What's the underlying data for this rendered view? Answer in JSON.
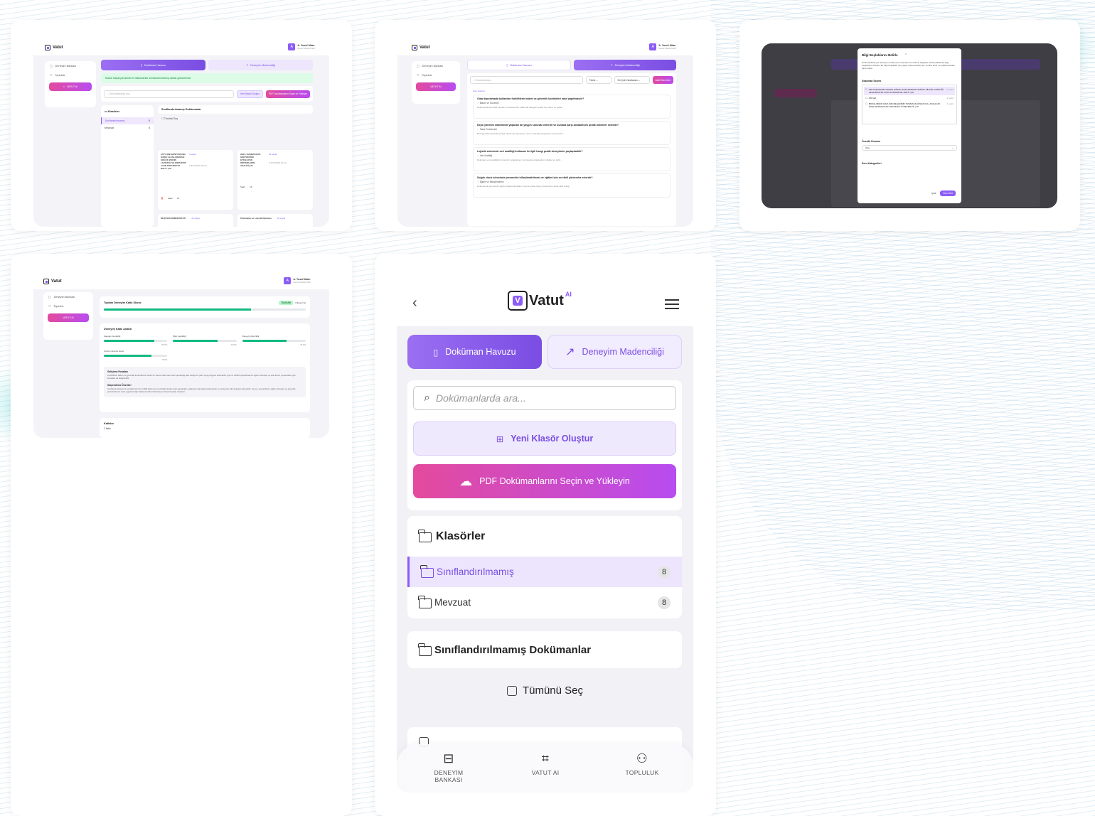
{
  "app": {
    "logo_text": "Vatut",
    "logo_superscript": "AI",
    "user_initial": "A",
    "user_name": "A. Yusuf Altan",
    "user_role": "Genel Müdür/CEO"
  },
  "sidebar": {
    "items": [
      "Deneyim Bankası",
      "Topluluk"
    ],
    "vatut_button": "VATUT AI"
  },
  "tabs": {
    "document_pool": "Doküman Havuzu",
    "experience_mining": "Deneyim Madenciliği"
  },
  "screen1": {
    "success_message": "Klasör başarıyla silindi ve dokümanlar sınıflandırılmamış olarak güncellendi.",
    "search_placeholder": "Dokümanlarda ara...",
    "new_folder": "Yeni Klasör Oluştur",
    "upload": "PDF Dokümanlarını Seçin ve Yükleyin",
    "folders_title": "Klasörler",
    "folders": [
      {
        "name": "Sınıflandırılmamış",
        "count": "8"
      },
      {
        "name": "Mevzuat",
        "count": "8"
      }
    ],
    "unclassified_title": "Sınıflandırılmamış Dokümanlar",
    "select_all": "Tümünü Seç",
    "docs": [
      {
        "title": "ATP KONVANSİYONUNA GÖRE ULUSLARARASI SOĞUK ZİNCİR LOJİSTİĞİ VE ENDÜSTRİ 4.0'IN POTANSİYEL ROLÜ .pdf",
        "pages": "3 sayfa",
        "date": "(14/02/2025 00:11)",
        "toggle": "Vatut-Analiz",
        "edit": "Sadır",
        "count": "16"
      },
      {
        "title": "GIDA TAŞIMACILIĞI SEKTÖRÜNÜ ETKİLEYEN KRİTERLERİN ANALİZİ.pdf",
        "pages": "44 sayfa",
        "date": "(14/02/2025 00:11)",
        "toggle": "Vatut-Analiz",
        "edit": "Sadır",
        "count": "16"
      },
      {
        "title": "MÜŞTERİ MEMNUNİYETİ",
        "pages": "22 sayfa"
      },
      {
        "title": "Pazarlama ve Lojistik İlişkisine",
        "pages": "29 sayfa"
      }
    ]
  },
  "screen2": {
    "search_placeholder": "Sorularda ara...",
    "filter_topic": "Tümü",
    "filter_sort": "En Çok Yanıtlanan",
    "generate": "Akıllı Soru Üret",
    "section_label": "Soru Havuzu",
    "questions": [
      {
        "title": "Gıda depolamada kullanılan forkliftlerin bakım ve güvenlik kontrolleri nasıl yapılmalıdır?",
        "tag": "Bakım ve Güvenlik",
        "desc": "Dokümanlarda forklift yapıları ve kullanımları hakkında detaylar verilse da, bakım ve güven..."
      },
      {
        "title": "Depo yönetim sisteminde yaşanan arı yaygın sorunlar nelerdir ve bunlara karşı alınabilecek pratik önlemler nelerdir?",
        "tag": "Saha Problemleri",
        "desc": "Bu bilgi dokümanlarda detaylı olarak ele alınmamış. Sorun sahada çalışanların deneyimleri..."
      },
      {
        "title": "Lojistik sürecinde veri analitiği kullanımı ile ilgili hangi pratik deneyimler paylaşılabilir?",
        "tag": "Veri Analitiği",
        "desc": "Doküman veri analitiğinin önemini vurgulanken, bu süreçte karşılaşılan zorluklar ve çözü..."
      },
      {
        "title": "Soğuk zincir sürecinde personelin bilinçlendirilmesi ve eğitimi için en etkili yöntemler nelerdir?",
        "tag": "Eğitim ve Bilinçlendirme",
        "desc": "Dokümanda personelin eğitimi hakkında bilgiler mevcut ancak hangi yöntemlerin daha etkili olduğ..."
      }
    ]
  },
  "screen3": {
    "modal_title": "Bilgi Boşluklarını Belirle",
    "modal_desc": "Dokümanlarda yer almayan ancak kurum içindeki uzmanların bilgisiyle doldurulabilecek bilgi boşluklarını belirler. Bu bilgi boşlukları için yapay zeka destekli yeni sorular üretir ve kullanıcılardan yanıt toplar.",
    "doc_selection_label": "Doküman Seçimi",
    "doc_options": [
      {
        "title": "ATP KONVANSİYONUNA GÖRE ULUSLARARASI SOĞUK ZİNCİR LOJİSTİĞİ VE ENDÜSTRİ 4.0'IN POTANSİYEL ROLÜ .pdf",
        "pages": "3 sayfa"
      },
      {
        "title": "ATP.pdf",
        "pages": "3 sayfa"
      },
      {
        "title": "BOZULABİLİR GIDA MADDELERİNİN TAŞIMACILIĞINDA KULLANILACAK ÖZEL EKİPMANLAR HAKKINDA YÖNETMELİK .pdf",
        "pages": "4 sayfa"
      }
    ],
    "priority_label": "Öncelik Durumu",
    "priority_value": "Orta",
    "category_label": "Soru Kategorileri",
    "cancel": "İptal",
    "submit": "Soru Üret"
  },
  "screen4": {
    "score_title": "Toplam Deneyim Katkı Skoru:",
    "score_value": "73.0/100",
    "score_tag": "Yüksek Üst",
    "score_progress": 0.73,
    "analysis_title": "Deneyim Katkı Analizi",
    "metrics": [
      {
        "label": "Kapsam Genişliği",
        "value": "80.0%",
        "fill": 0.8
      },
      {
        "label": "Bilgi Çeşitliliği",
        "value": "70.0%",
        "fill": 0.7
      },
      {
        "label": "Deneyim Derinliği",
        "value": "70.0%",
        "fill": 0.7
      },
      {
        "label": "Çözüm Üretme Gücü",
        "value": "75.0%",
        "fill": 0.75
      }
    ],
    "dev_title": "Gelişirme Fırsatları",
    "dev_text": "Forkliftlerin bakım ve güvenlik kontrollerinin belirli bir zaman diliminde nasıl yapılacağı dair detaylı bir plan veya program eklenebilir. Ayrıca, forklift operatörlerinin eğitim süreçleri ve acil durum prosedürleri gibi konulara da değinilebilir.",
    "strength_title": "Güçlendirme Önerileri",
    "strength_text": "Sınıflama kapsamını genişletmek için forklift bakımının periyodik olarak nasıl yapılacağı, kullanılan teknolojik ekipmanları ve yöntemler gibi detaylar eklenebilir. Ayrıca, operatörlerin eğitim süreçleri ve güvenlik protokollerinin nasıl uygulanacağı hakkında daha fazla bilgi verilmesi faydalı olacaktır.",
    "contributions_title": "Katkılar",
    "contributions_count": "2 katkı"
  },
  "mobile": {
    "search_placeholder": "Dokümanlarda ara...",
    "bottom_nav": [
      {
        "label": "DENEYİM BANKASI"
      },
      {
        "label": "VATUT AI"
      },
      {
        "label": "TOPLULUK"
      }
    ]
  }
}
